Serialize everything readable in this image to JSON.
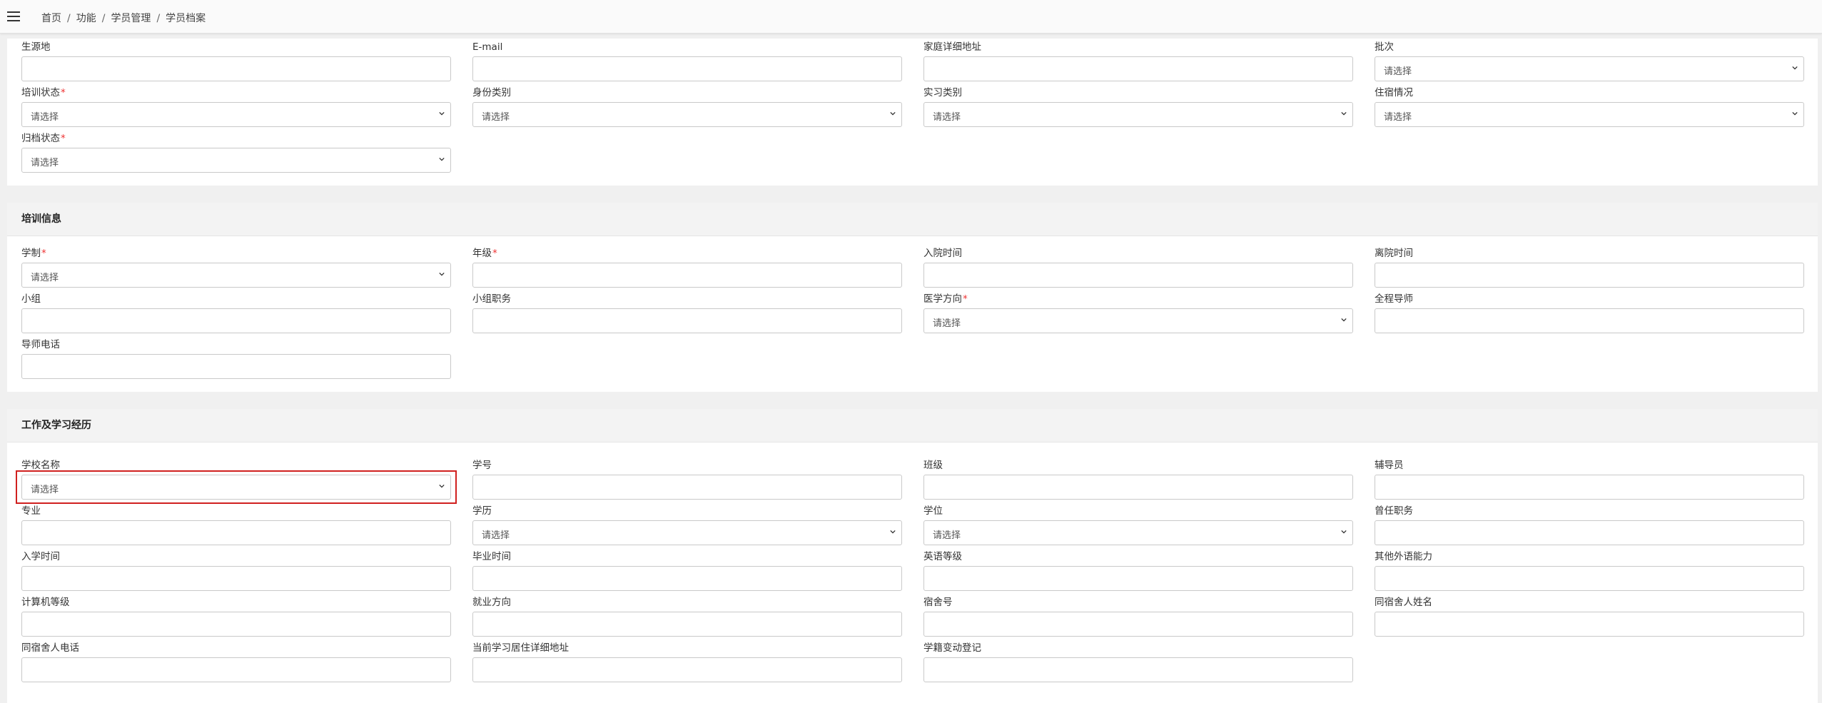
{
  "breadcrumb": [
    "首页",
    "功能",
    "学员管理",
    "学员档案"
  ],
  "placeholder_select": "请选择",
  "sections": {
    "basic": {
      "fields": [
        {
          "label": "生源地",
          "type": "input"
        },
        {
          "label": "E-mail",
          "type": "input"
        },
        {
          "label": "家庭详细地址",
          "type": "input"
        },
        {
          "label": "批次",
          "type": "select"
        },
        {
          "label": "培训状态",
          "type": "select",
          "required": true
        },
        {
          "label": "身份类别",
          "type": "select"
        },
        {
          "label": "实习类别",
          "type": "select"
        },
        {
          "label": "住宿情况",
          "type": "select"
        },
        {
          "label": "归档状态",
          "type": "select",
          "required": true
        }
      ]
    },
    "training": {
      "title": "培训信息",
      "fields": [
        {
          "label": "学制",
          "type": "select",
          "required": true
        },
        {
          "label": "年级",
          "type": "input",
          "required": true
        },
        {
          "label": "入院时间",
          "type": "input"
        },
        {
          "label": "离院时间",
          "type": "input"
        },
        {
          "label": "小组",
          "type": "input"
        },
        {
          "label": "小组职务",
          "type": "input"
        },
        {
          "label": "医学方向",
          "type": "select",
          "required": true
        },
        {
          "label": "全程导师",
          "type": "input"
        },
        {
          "label": "导师电话",
          "type": "input"
        }
      ]
    },
    "experience": {
      "title": "工作及学习经历",
      "fields": [
        {
          "label": "学校名称",
          "type": "select",
          "highlighted": true
        },
        {
          "label": "学号",
          "type": "input"
        },
        {
          "label": "班级",
          "type": "input"
        },
        {
          "label": "辅导员",
          "type": "input"
        },
        {
          "label": "专业",
          "type": "input"
        },
        {
          "label": "学历",
          "type": "select"
        },
        {
          "label": "学位",
          "type": "select"
        },
        {
          "label": "曾任职务",
          "type": "input"
        },
        {
          "label": "入学时间",
          "type": "input"
        },
        {
          "label": "毕业时间",
          "type": "input"
        },
        {
          "label": "英语等级",
          "type": "input"
        },
        {
          "label": "其他外语能力",
          "type": "input"
        },
        {
          "label": "计算机等级",
          "type": "input"
        },
        {
          "label": "就业方向",
          "type": "input"
        },
        {
          "label": "宿舍号",
          "type": "input"
        },
        {
          "label": "同宿舍人姓名",
          "type": "input"
        },
        {
          "label": "同宿舍人电话",
          "type": "input"
        },
        {
          "label": "当前学习居住详细地址",
          "type": "input"
        },
        {
          "label": "学籍变动登记",
          "type": "input"
        }
      ]
    }
  },
  "colors": {
    "required_mark": "#e33333",
    "highlight_border": "#d0201f"
  }
}
